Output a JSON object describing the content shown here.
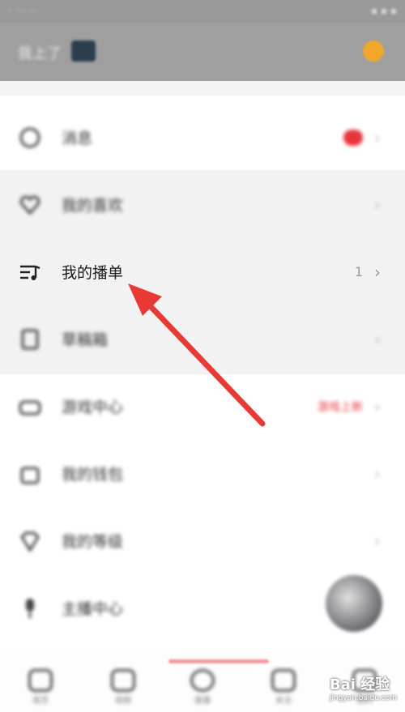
{
  "status_bar": {
    "left": "·· ··· ···",
    "right": "▪ ▪ ▪"
  },
  "header": {
    "username": "我上了"
  },
  "menu": [
    {
      "label": "消息",
      "right_value": "",
      "icon": "message-icon"
    },
    {
      "label": "我的喜欢",
      "right_value": "",
      "icon": "heart-icon"
    },
    {
      "label": "我的播单",
      "right_value": "1",
      "icon": "playlist-icon"
    },
    {
      "label": "草稿箱",
      "right_value": "",
      "icon": "draft-icon"
    },
    {
      "label": "游戏中心",
      "right_value": "游戏上新",
      "icon": "game-icon"
    },
    {
      "label": "我的钱包",
      "right_value": "",
      "icon": "wallet-icon"
    },
    {
      "label": "我的等级",
      "right_value": "",
      "icon": "level-icon"
    },
    {
      "label": "主播中心",
      "right_value": "",
      "icon": "mic-icon"
    }
  ],
  "tabs": [
    {
      "label": "首页",
      "icon": "home-icon"
    },
    {
      "label": "视频",
      "icon": "video-icon"
    },
    {
      "label": "直播",
      "icon": "live-icon"
    },
    {
      "label": "关注",
      "icon": "star-icon"
    },
    {
      "label": "我的",
      "icon": "profile-icon"
    }
  ],
  "watermark": {
    "brand": "Bai 经验",
    "domain": "jingyan.baidu.com"
  },
  "colors": {
    "accent_red": "#e8353a",
    "arrow": "#e83a35",
    "header_gray": "#9f9f9f"
  }
}
